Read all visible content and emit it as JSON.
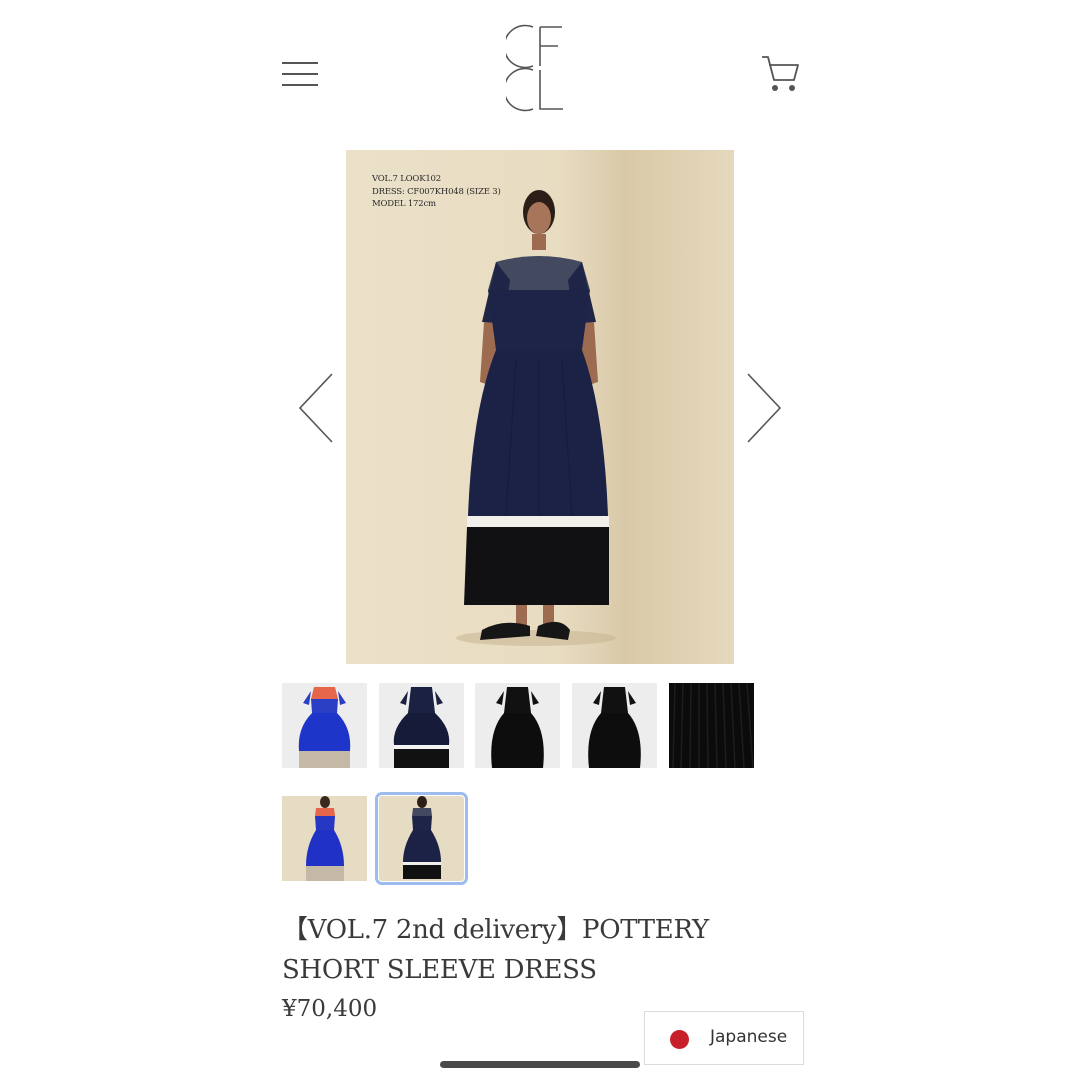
{
  "header": {
    "logo_text": "CFCL",
    "menu_icon": "hamburger-menu-icon",
    "cart_icon": "shopping-cart-icon"
  },
  "gallery": {
    "caption_lines": [
      "VOL.7 LOOK102",
      "DRESS: CF007KH048 (SIZE 3)",
      "MODEL 172cm"
    ],
    "prev_icon": "chevron-left-icon",
    "next_icon": "chevron-right-icon",
    "thumbnails": [
      {
        "alt": "blue dress with orange neckline and beige hem",
        "selected": false
      },
      {
        "alt": "navy dress with white stripe",
        "selected": false
      },
      {
        "alt": "black dress front",
        "selected": false
      },
      {
        "alt": "black dress back",
        "selected": false
      },
      {
        "alt": "black ribbed knit detail",
        "selected": false
      },
      {
        "alt": "model in blue dress",
        "selected": false
      },
      {
        "alt": "model in navy dress",
        "selected": true
      }
    ]
  },
  "product": {
    "title": "【VOL.7 2nd delivery】POTTERY SHORT SLEEVE DRESS",
    "price": "¥70,400"
  },
  "language": {
    "label": "Japanese",
    "flag_color": "#c8202a"
  },
  "colors": {
    "selected_outline": "#9bbcec",
    "navy": "#1c2346",
    "beige_bg": "#e9dcc1"
  }
}
